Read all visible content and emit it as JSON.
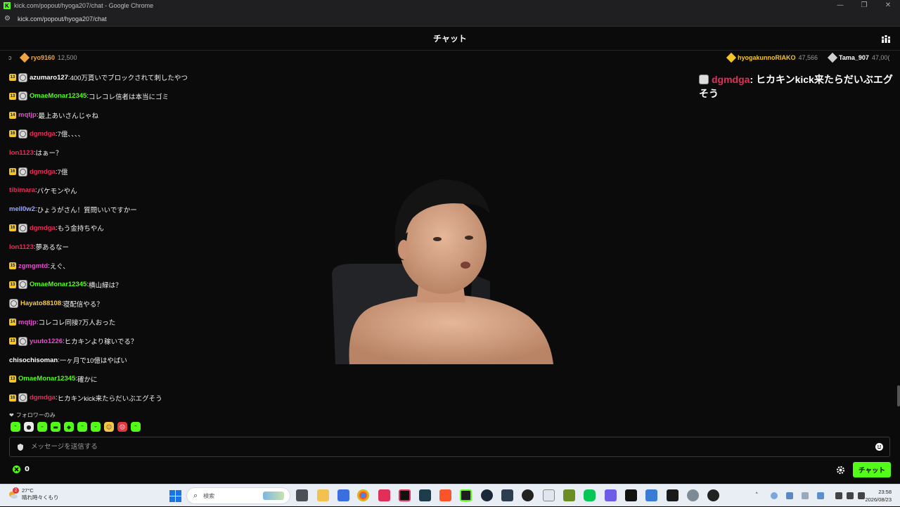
{
  "window": {
    "title": "kick.com/popout/hyoga207/chat - Google Chrome",
    "url": "kick.com/popout/hyoga207/chat"
  },
  "chat": {
    "header_title": "チャット",
    "pinned": [
      {
        "name": "ryo9160",
        "amount": "12,500",
        "color": "#f0a640"
      },
      {
        "name": "hyogakunnoRIAKO",
        "amount": "47,566",
        "color": "#f5c623"
      },
      {
        "name": "Tama_907",
        "amount": "47,00(",
        "color": "#cfcfcf"
      }
    ],
    "messages": [
      {
        "badge": "13",
        "avatar": true,
        "user": "azumaro127",
        "color": "#ffffff",
        "text": "400万貰いでブロックされて刺したやつ"
      },
      {
        "badge": "13",
        "avatar": true,
        "user": "OmaeMonar12345",
        "color": "#53fc18",
        "text": "コレコレ信者は本当にゴミ"
      },
      {
        "badge": "14",
        "avatar": false,
        "user": "mqtjp",
        "color": "#e84ccf",
        "text": "最上あいさんじゃね"
      },
      {
        "badge": "16",
        "avatar": true,
        "user": "dgmdga",
        "color": "#e0305a",
        "text": "7億、、、、"
      },
      {
        "badge": "",
        "avatar": false,
        "user": "lon1123",
        "color": "#e0305a",
        "text": "はぁー？"
      },
      {
        "badge": "16",
        "avatar": true,
        "user": "dgmdga",
        "color": "#e0305a",
        "text": "7億"
      },
      {
        "badge": "",
        "avatar": false,
        "user": "tibimara",
        "color": "#e0305a",
        "text": "バケモンやん"
      },
      {
        "badge": "",
        "avatar": false,
        "user": "mell0w2",
        "color": "#9aa7ff",
        "text": "ひょうがさん！質問いいですかー"
      },
      {
        "badge": "16",
        "avatar": true,
        "user": "dgmdga",
        "color": "#e0305a",
        "text": "もう金持ちやん"
      },
      {
        "badge": "",
        "avatar": false,
        "user": "lon1123",
        "color": "#e0305a",
        "text": "夢あるなー"
      },
      {
        "badge": "15",
        "avatar": false,
        "user": "zgmgmtd",
        "color": "#e84ccf",
        "text": "えぐ、"
      },
      {
        "badge": "13",
        "avatar": true,
        "user": "OmaeMonar12345",
        "color": "#53fc18",
        "text": "横山緑は？"
      },
      {
        "badge": "",
        "avatar": true,
        "user": "Hayato88108",
        "color": "#f5c842",
        "text": "寝配信やる？"
      },
      {
        "badge": "14",
        "avatar": false,
        "user": "mqtjp",
        "color": "#e84ccf",
        "text": "コレコレ同接7万人おった"
      },
      {
        "badge": "13",
        "avatar": true,
        "user": "yuuto1226",
        "color": "#e84ccf",
        "text": "ヒカキンより稼いでる？"
      },
      {
        "badge": "",
        "avatar": false,
        "user": "chisochisoman",
        "color": "#ffffff",
        "text": "一ヶ月で10億はやばい"
      },
      {
        "badge": "13",
        "avatar": false,
        "user": "OmaeMonar12345",
        "color": "#53fc18",
        "text": "確かに"
      },
      {
        "badge": "16",
        "avatar": true,
        "user": "dgmdga",
        "color": "#e0305a",
        "text": "ヒカキンkick来たらだいぶエグそう"
      }
    ],
    "overlay": {
      "user": "dgmdga",
      "separator": ":",
      "text": "ヒカキンkick来たらだいぶエグそう",
      "user_color": "#e0305a"
    },
    "follower_only": "フォロワーのみ",
    "input_placeholder": "メッセージを送信する",
    "points": "0",
    "send_label": "チャット",
    "accent": "#53fc18"
  },
  "taskbar": {
    "weather_temp": "27°C",
    "weather_desc": "晴れ時々くもり",
    "weather_badge": "2",
    "search_label": "検索",
    "time": "23:58",
    "date": "2026/08/23"
  }
}
